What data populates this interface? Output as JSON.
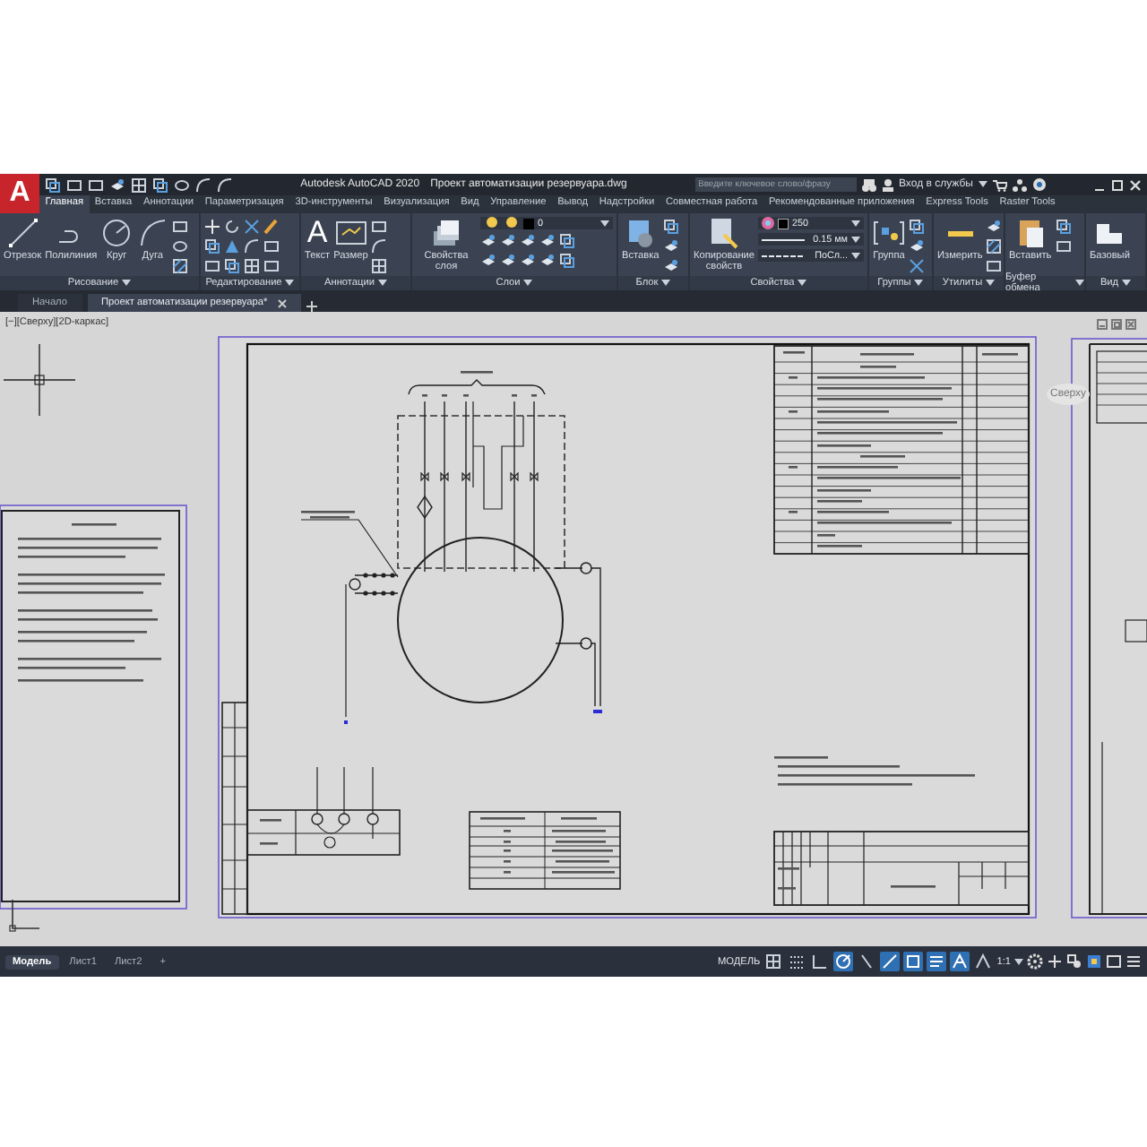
{
  "window": {
    "logo": "A",
    "app_title": "Autodesk AutoCAD 2020",
    "file_title": "Проект автоматизации резервуара.dwg",
    "search": {
      "placeholder": "Введите ключевое слово/фразу"
    },
    "sign_in": "Вход в службы"
  },
  "ribbon_tabs": [
    {
      "label": "Главная",
      "selected": true
    },
    {
      "label": "Вставка",
      "selected": false
    },
    {
      "label": "Аннотации",
      "selected": false
    },
    {
      "label": "Параметризация",
      "selected": false
    },
    {
      "label": "3D-инструменты",
      "selected": false
    },
    {
      "label": "Визуализация",
      "selected": false
    },
    {
      "label": "Вид",
      "selected": false
    },
    {
      "label": "Управление",
      "selected": false
    },
    {
      "label": "Вывод",
      "selected": false
    },
    {
      "label": "Надстройки",
      "selected": false
    },
    {
      "label": "Совместная работа",
      "selected": false
    },
    {
      "label": "Рекомендованные приложения",
      "selected": false
    },
    {
      "label": "Express Tools",
      "selected": false
    },
    {
      "label": "Raster Tools",
      "selected": false
    }
  ],
  "ribbon_panels": [
    {
      "kind": "draw",
      "title": "Рисование",
      "tools": [
        {
          "label": "Отрезок"
        },
        {
          "label": "Полилиния"
        },
        {
          "label": "Круг"
        },
        {
          "label": "Дуга"
        }
      ]
    },
    {
      "kind": "modify",
      "title": "Редактирование"
    },
    {
      "kind": "annotation",
      "title": "Аннотации",
      "tools": [
        {
          "glyph": "A",
          "label": "Текст"
        },
        {
          "label": "Размер"
        }
      ]
    },
    {
      "kind": "layers",
      "title": "Слои",
      "tools": [
        {
          "label": "Свойства слоя"
        }
      ],
      "fields": [
        {
          "kind": "layer",
          "value": "0"
        }
      ]
    },
    {
      "kind": "block",
      "title": "Блок",
      "tools": [
        {
          "label": "Вставка"
        }
      ]
    },
    {
      "kind": "properties",
      "title": "Свойства",
      "tools": [
        {
          "label": "Копирование свойств"
        }
      ],
      "fields": [
        {
          "kind": "color",
          "value": "250"
        },
        {
          "kind": "lineweight",
          "value": "0.15 мм"
        },
        {
          "kind": "linetype",
          "value": "ПоСл..."
        }
      ]
    },
    {
      "kind": "groups",
      "title": "Группы",
      "tools": [
        {
          "label": "Группа"
        }
      ]
    },
    {
      "kind": "utilities",
      "title": "Утилиты",
      "tools": [
        {
          "label": "Измерить"
        }
      ]
    },
    {
      "kind": "clipboard",
      "title": "Буфер обмена",
      "tools": [
        {
          "label": "Вставить"
        }
      ]
    },
    {
      "kind": "view",
      "title": "Вид",
      "tools": [
        {
          "label": "Базовый"
        }
      ]
    }
  ],
  "document_tabs": [
    {
      "label": "Начало",
      "selected": false
    },
    {
      "label": "Проект автоматизации резервуара*",
      "selected": true
    }
  ],
  "viewport": {
    "label": "[−][Сверху][2D-каркас]",
    "viewcube": "Сверху"
  },
  "status_bar": {
    "layout_tabs": [
      {
        "label": "Модель",
        "selected": true
      },
      {
        "label": "Лист1",
        "selected": false
      },
      {
        "label": "Лист2",
        "selected": false
      }
    ],
    "add_tab": "+",
    "space": "МОДЕЛЬ",
    "scale": "1:1",
    "toggles": [
      {
        "kind": "grid",
        "on": false
      },
      {
        "kind": "snap",
        "on": false
      },
      {
        "kind": "ortho",
        "on": false
      },
      {
        "kind": "polar",
        "on": true
      },
      {
        "kind": "isometric",
        "on": false
      },
      {
        "kind": "tracking",
        "on": true
      },
      {
        "kind": "osnap",
        "on": true
      },
      {
        "kind": "lineweight",
        "on": true
      },
      {
        "kind": "annotation",
        "on": true
      },
      {
        "kind": "autoscale",
        "on": false
      }
    ]
  }
}
